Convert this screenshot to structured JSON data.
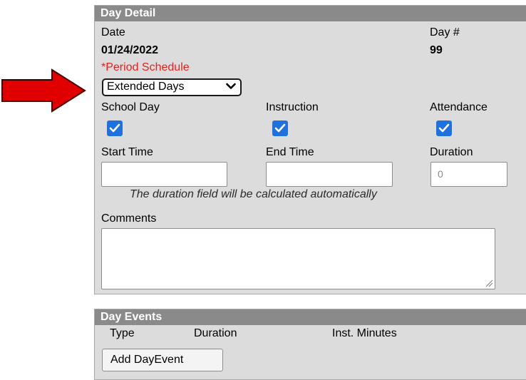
{
  "day_detail": {
    "title": "Day Detail",
    "date_label": "Date",
    "date_value": "01/24/2022",
    "day_number_label": "Day #",
    "day_number_value": "99",
    "period_schedule_label": "*Period Schedule",
    "period_schedule_selected": "Extended Days",
    "school_day_label": "School Day",
    "school_day_checked": true,
    "instruction_label": "Instruction",
    "instruction_checked": true,
    "attendance_label": "Attendance",
    "attendance_checked": true,
    "start_time_label": "Start Time",
    "start_time_value": "",
    "end_time_label": "End Time",
    "end_time_value": "",
    "duration_label": "Duration",
    "duration_value": "0",
    "duration_hint": "The duration field will be calculated automatically",
    "comments_label": "Comments",
    "comments_value": ""
  },
  "day_events": {
    "title": "Day Events",
    "columns": [
      "Type",
      "Duration",
      "Inst. Minutes"
    ],
    "add_button_label": "Add DayEvent"
  },
  "annotation": {
    "arrow_color": "#e00000",
    "arrow_target": "period-schedule-select"
  },
  "colors": {
    "panel_bg": "#dcdcdc",
    "header_bg": "#8a8a8a",
    "required_red": "#e32222",
    "checkbox_blue": "#1f72de"
  }
}
